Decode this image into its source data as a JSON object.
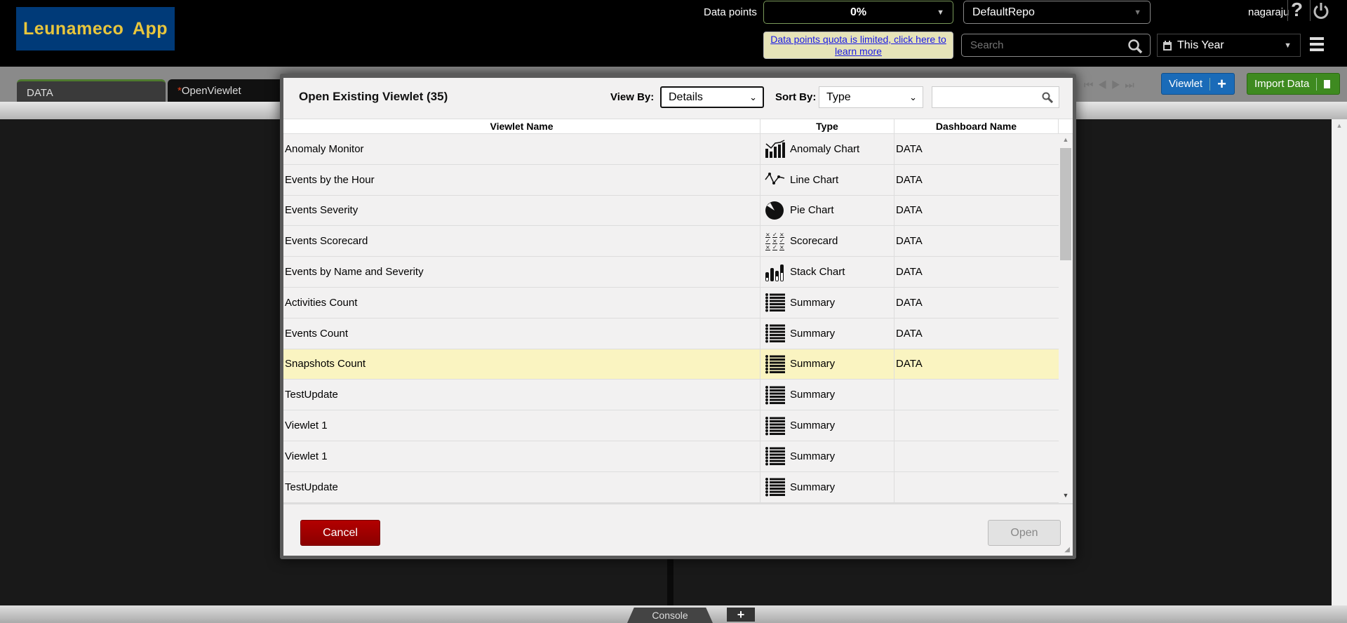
{
  "header": {
    "logo": "Leunameco App",
    "data_points_label": "Data points",
    "data_points_value": "0%",
    "repo": "DefaultRepo",
    "quota_link": "Data points quota is limited, click here to learn more",
    "search_placeholder": "Search",
    "time_range": "This Year",
    "username": "nagaraju"
  },
  "tabs": [
    {
      "label": "DATA",
      "active": false
    },
    {
      "label": "OpenViewlet",
      "modified_marker": "*",
      "active": true
    }
  ],
  "toolbar": {
    "viewlet_button": "Viewlet",
    "import_button": "Import Data"
  },
  "dialog": {
    "title": "Open Existing Viewlet (35)",
    "view_by_label": "View By:",
    "view_by_value": "Details",
    "sort_by_label": "Sort By:",
    "sort_by_value": "Type",
    "filter_value": "",
    "columns": [
      "Viewlet Name",
      "Type",
      "Dashboard Name"
    ],
    "rows": [
      {
        "name": "Anomaly Monitor",
        "type": "Anomaly Chart",
        "icon": "anomaly-chart-icon",
        "dashboard": "DATA"
      },
      {
        "name": "Events by the Hour",
        "type": "Line Chart",
        "icon": "line-chart-icon",
        "dashboard": "DATA"
      },
      {
        "name": "Events Severity",
        "type": "Pie Chart",
        "icon": "pie-chart-icon",
        "dashboard": "DATA"
      },
      {
        "name": "Events Scorecard",
        "type": "Scorecard",
        "icon": "scorecard-icon",
        "dashboard": "DATA"
      },
      {
        "name": "Events by Name and Severity",
        "type": "Stack Chart",
        "icon": "stack-chart-icon",
        "dashboard": "DATA"
      },
      {
        "name": "Activities Count",
        "type": "Summary",
        "icon": "summary-icon",
        "dashboard": "DATA"
      },
      {
        "name": "Events Count",
        "type": "Summary",
        "icon": "summary-icon",
        "dashboard": "DATA"
      },
      {
        "name": "Snapshots Count",
        "type": "Summary",
        "icon": "summary-icon",
        "dashboard": "DATA",
        "selected": true
      },
      {
        "name": "TestUpdate",
        "type": "Summary",
        "icon": "summary-icon",
        "dashboard": ""
      },
      {
        "name": "Viewlet 1",
        "type": "Summary",
        "icon": "summary-icon",
        "dashboard": ""
      },
      {
        "name": "Viewlet 1",
        "type": "Summary",
        "icon": "summary-icon",
        "dashboard": ""
      },
      {
        "name": "TestUpdate",
        "type": "Summary",
        "icon": "summary-icon",
        "dashboard": ""
      }
    ],
    "cancel": "Cancel",
    "open": "Open",
    "selected_row_color": "#faf4c1"
  },
  "bottom": {
    "console_tab": "Console"
  }
}
